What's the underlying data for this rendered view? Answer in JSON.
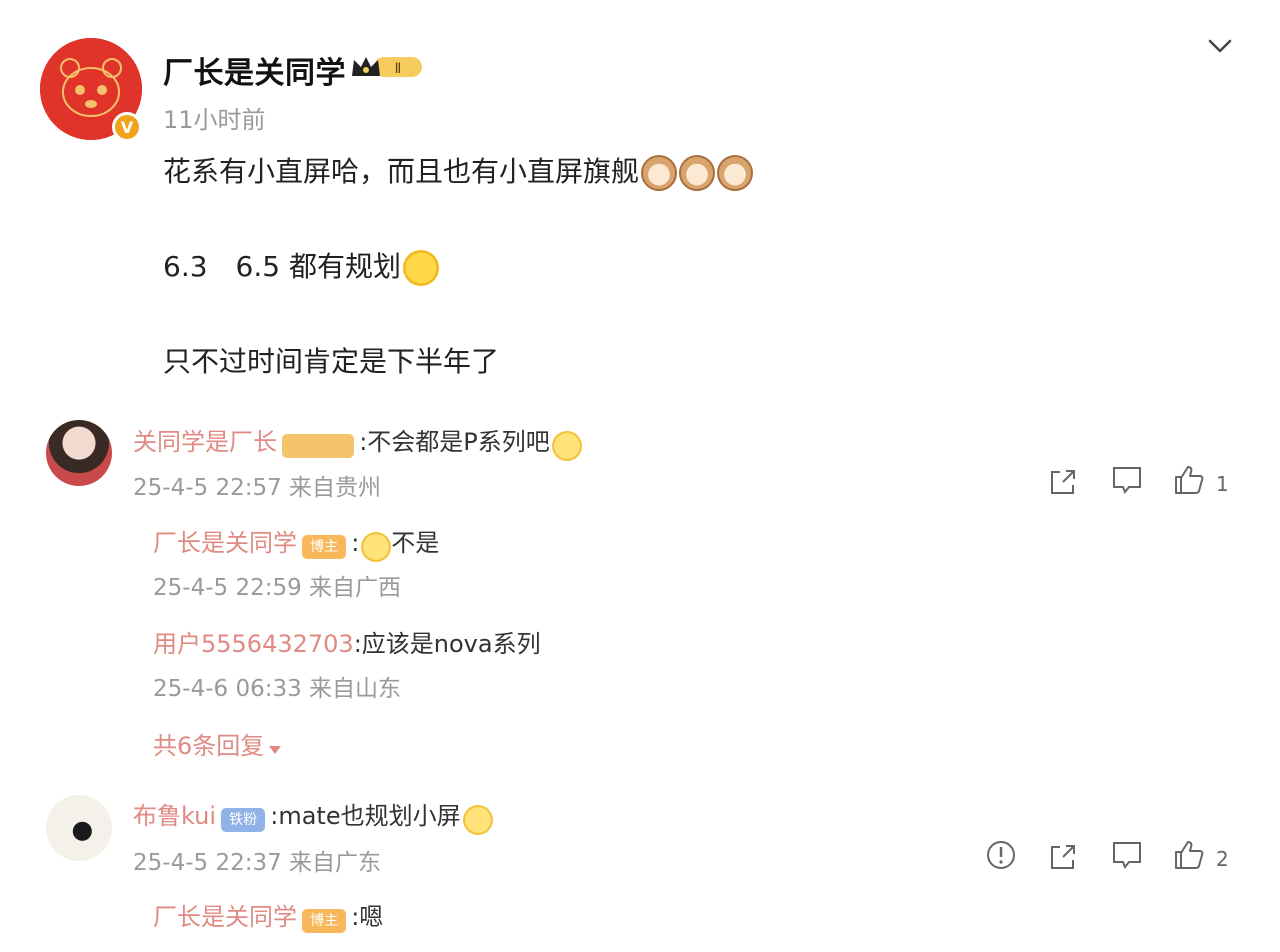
{
  "post": {
    "author": "厂长是关同学",
    "badge_level": "Ⅱ",
    "verified_mark": "V",
    "time": "11小时前",
    "lines": [
      "花系有小直屏哈，而且也有小直屏旗舰",
      "6.3　6.5  都有规划",
      "只不过时间肯定是下半年了"
    ]
  },
  "comments": [
    {
      "name": "关同学是厂长",
      "badge": "",
      "text": ":不会都是P系列吧",
      "meta": "25-4-5 22:57 来自贵州",
      "likes": "1",
      "replies": [
        {
          "name": "厂长是关同学",
          "tag": "博主",
          "text": "不是",
          "meta": "25-4-5 22:59 来自广西"
        },
        {
          "name": "用户5556432703",
          "tag": "",
          "text": ":应该是nova系列",
          "meta": "25-4-6 06:33 来自山东"
        }
      ],
      "more": "共6条回复"
    },
    {
      "name": "布鲁kui",
      "badge": "铁粉",
      "text": ":mate也规划小屏",
      "meta": "25-4-5 22:37 来自广东",
      "likes": "2",
      "replies": [
        {
          "name": "厂长是关同学",
          "tag": "博主",
          "text": ":嗯"
        }
      ]
    }
  ],
  "icons": {
    "collapse": "chevron-down-icon",
    "share": "share-icon",
    "comment": "comment-icon",
    "like": "thumbs-up-icon",
    "report": "report-icon"
  },
  "colors": {
    "name": "#e08a83",
    "avatar": "#e0342a",
    "verified": "#f0a21a"
  }
}
